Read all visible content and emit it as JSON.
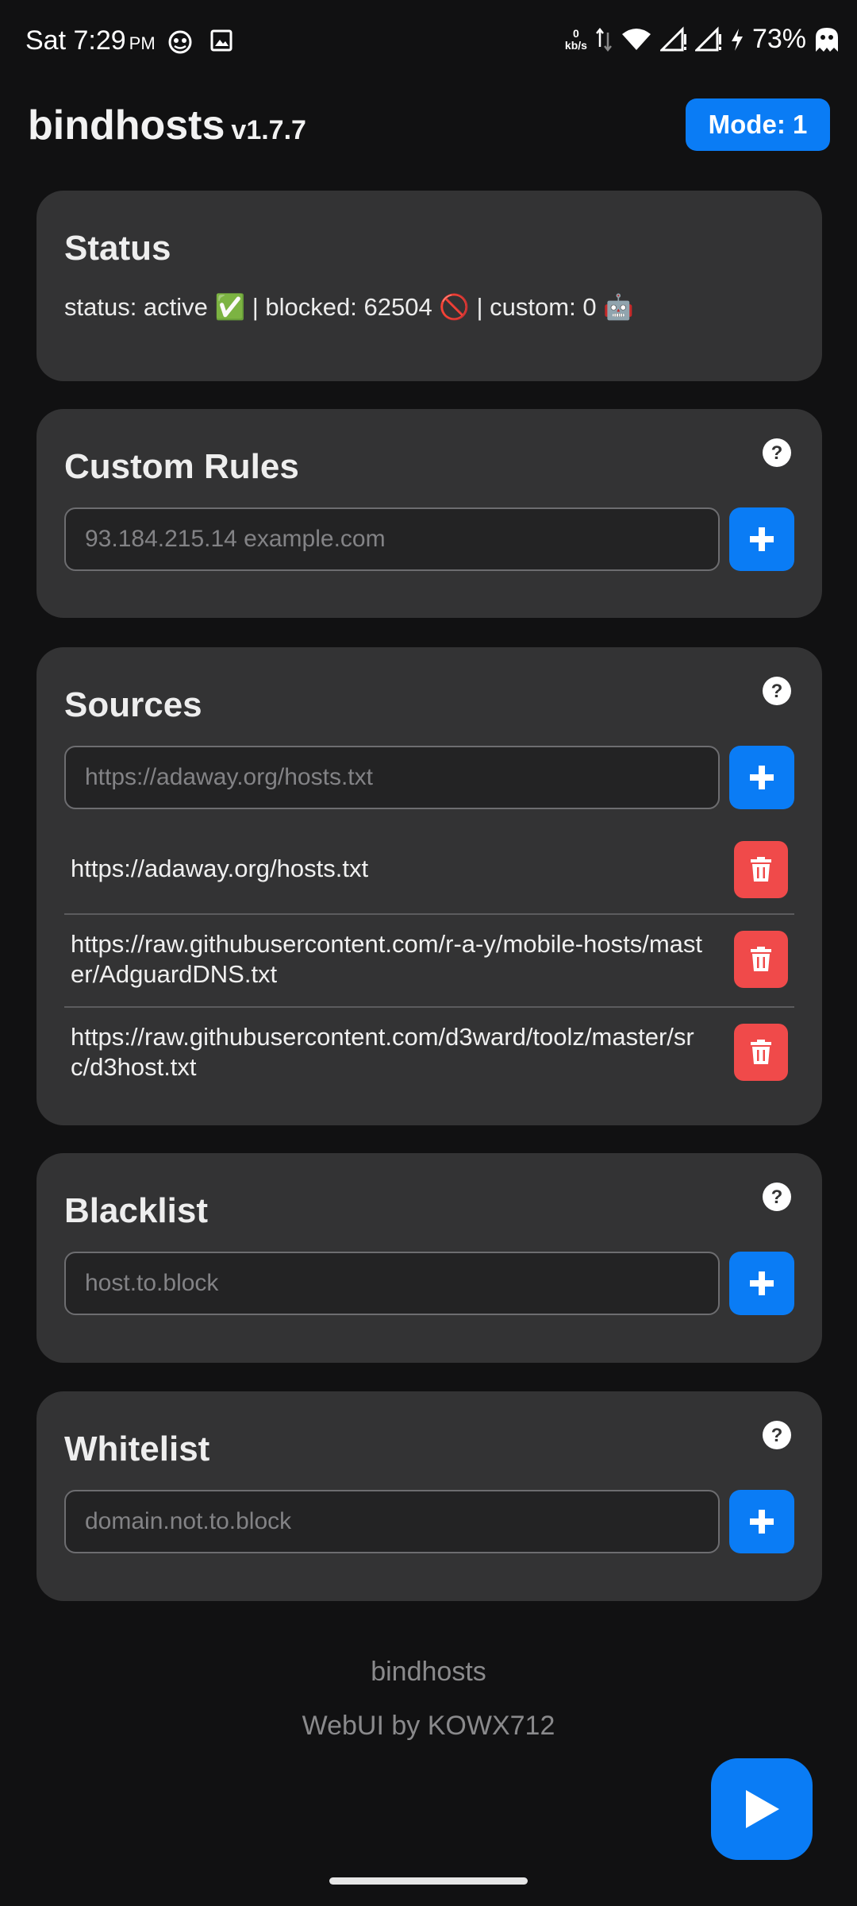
{
  "status_bar": {
    "time": "Sat 7:29",
    "ampm": "PM",
    "net_speed_value": "0",
    "net_speed_unit": "kb/s",
    "battery": "73%"
  },
  "header": {
    "title": "bindhosts",
    "version": "v1.7.7",
    "mode_label": "Mode: 1"
  },
  "status_card": {
    "title": "Status",
    "text": "status: active ✅ | blocked: 62504 🚫 | custom: 0 🤖"
  },
  "custom_rules": {
    "title": "Custom Rules",
    "placeholder": "93.184.215.14 example.com"
  },
  "sources": {
    "title": "Sources",
    "placeholder": "https://adaway.org/hosts.txt",
    "items": [
      "https://adaway.org/hosts.txt",
      "https://raw.githubusercontent.com/r-a-y/mobile-hosts/master/AdguardDNS.txt",
      "https://raw.githubusercontent.com/d3ward/toolz/master/src/d3host.txt"
    ]
  },
  "blacklist": {
    "title": "Blacklist",
    "placeholder": "host.to.block"
  },
  "whitelist": {
    "title": "Whitelist",
    "placeholder": "domain.not.to.block"
  },
  "footer": {
    "line1": "bindhosts",
    "line2": "WebUI by KOWX712"
  },
  "colors": {
    "accent": "#0a7cf5",
    "danger": "#f04a4a",
    "card": "#333334",
    "background": "#111112"
  }
}
